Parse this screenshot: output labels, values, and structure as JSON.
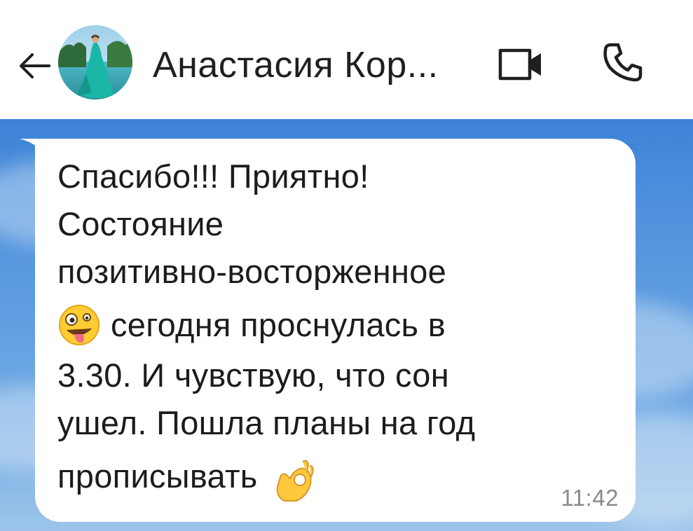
{
  "header": {
    "contact_name": "Анастасия Кор...",
    "back_icon": "arrow-left-icon",
    "video_icon": "video-camera-icon",
    "call_icon": "phone-icon"
  },
  "message": {
    "lines": [
      "Спасибо!!! Приятно!",
      "Состояние",
      "позитивно-восторженное",
      "сегодня проснулась в",
      "3.30. И чувствую, что сон",
      "ушел. Пошла планы на год",
      "прописывать"
    ],
    "emoji_1": "zany-face-emoji",
    "emoji_2": "ok-hand-emoji",
    "time": "11:42"
  },
  "colors": {
    "chat_background_top": "#3d82d6",
    "chat_background_bottom": "#9cc4ea",
    "bubble": "#ffffff",
    "text": "#1c1c1c",
    "timestamp": "#8a8a8a"
  }
}
